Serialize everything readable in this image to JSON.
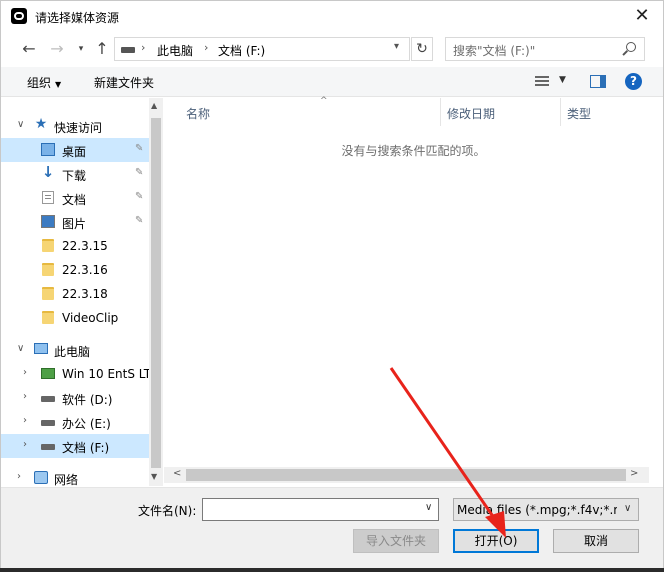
{
  "window": {
    "title": "请选择媒体资源"
  },
  "address": {
    "crumbs": [
      "此电脑",
      "文档 (F:)"
    ],
    "search_placeholder": "搜索\"文档 (F:)\""
  },
  "toolbar": {
    "organize": "组织",
    "new_folder": "新建文件夹"
  },
  "nav": {
    "quick_access": "快速访问",
    "items": [
      {
        "label": "桌面",
        "icon": "desktop-icon",
        "pinned": true,
        "selected": false
      },
      {
        "label": "下载",
        "icon": "download-icon",
        "pinned": true,
        "selected": false
      },
      {
        "label": "文档",
        "icon": "document-icon",
        "pinned": true,
        "selected": false
      },
      {
        "label": "图片",
        "icon": "pictures-icon",
        "pinned": true,
        "selected": false
      },
      {
        "label": "22.3.15",
        "icon": "folder-icon"
      },
      {
        "label": "22.3.16",
        "icon": "folder-icon"
      },
      {
        "label": "22.3.18",
        "icon": "folder-icon"
      },
      {
        "label": "VideoClip",
        "icon": "folder-icon"
      }
    ],
    "this_pc": "此电脑",
    "drives": [
      {
        "label": "Win 10 EntS LT",
        "icon": "network-drive-icon"
      },
      {
        "label": "软件 (D:)",
        "icon": "drive-icon"
      },
      {
        "label": "办公 (E:)",
        "icon": "drive-icon"
      },
      {
        "label": "文档 (F:)",
        "icon": "drive-icon",
        "selected": true
      }
    ],
    "network": "网络"
  },
  "columns": {
    "name": "名称",
    "date": "修改日期",
    "type": "类型"
  },
  "empty_message": "没有与搜索条件匹配的项。",
  "bottom": {
    "filename_label": "文件名(N):",
    "filename_value": "",
    "filetype_value": "Media files (*.mpg;*.f4v;*.mo",
    "import_folder": "导入文件夹",
    "open": "打开(O)",
    "cancel": "取消"
  },
  "annotation": {
    "arrow_color": "#e8231b"
  },
  "colors": {
    "selection": "#cce8ff",
    "primary_border": "#0078d7"
  }
}
